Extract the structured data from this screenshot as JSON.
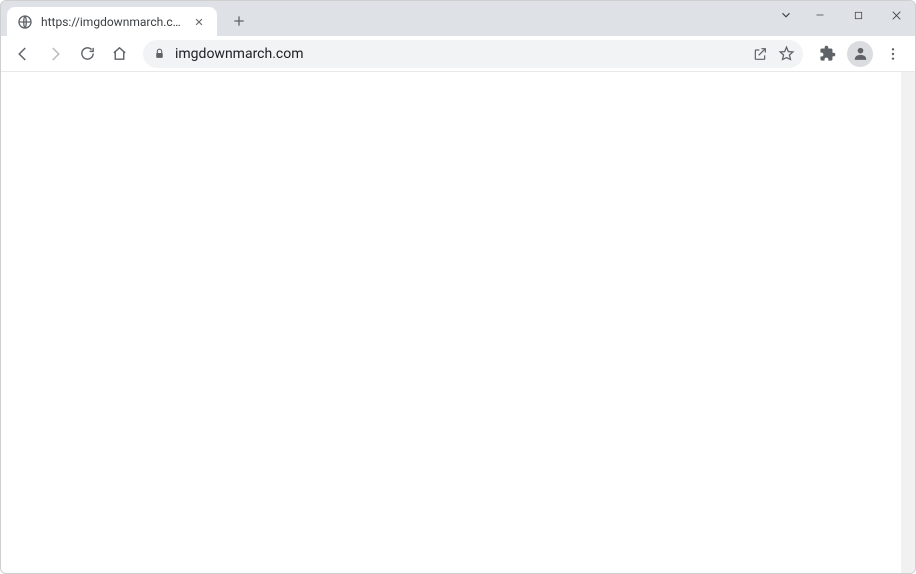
{
  "tab": {
    "title": "https://imgdownmarch.com"
  },
  "address": {
    "url": "imgdownmarch.com"
  }
}
